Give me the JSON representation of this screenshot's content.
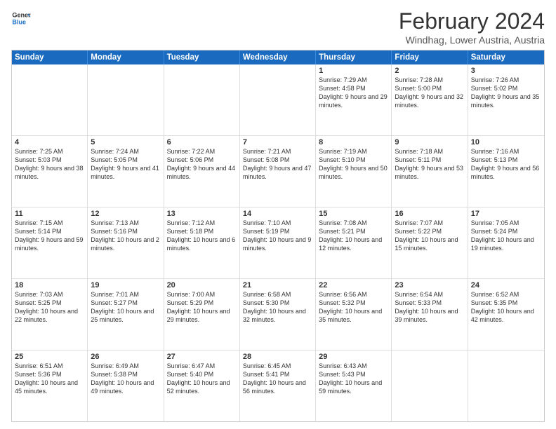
{
  "logo": {
    "line1": "General",
    "line2": "Blue"
  },
  "title": "February 2024",
  "location": "Windhag, Lower Austria, Austria",
  "weekdays": [
    "Sunday",
    "Monday",
    "Tuesday",
    "Wednesday",
    "Thursday",
    "Friday",
    "Saturday"
  ],
  "weeks": [
    [
      {
        "day": "",
        "info": ""
      },
      {
        "day": "",
        "info": ""
      },
      {
        "day": "",
        "info": ""
      },
      {
        "day": "",
        "info": ""
      },
      {
        "day": "1",
        "sunrise": "7:29 AM",
        "sunset": "4:58 PM",
        "daylight": "9 hours and 29 minutes."
      },
      {
        "day": "2",
        "sunrise": "7:28 AM",
        "sunset": "5:00 PM",
        "daylight": "9 hours and 32 minutes."
      },
      {
        "day": "3",
        "sunrise": "7:26 AM",
        "sunset": "5:02 PM",
        "daylight": "9 hours and 35 minutes."
      }
    ],
    [
      {
        "day": "4",
        "sunrise": "7:25 AM",
        "sunset": "5:03 PM",
        "daylight": "9 hours and 38 minutes."
      },
      {
        "day": "5",
        "sunrise": "7:24 AM",
        "sunset": "5:05 PM",
        "daylight": "9 hours and 41 minutes."
      },
      {
        "day": "6",
        "sunrise": "7:22 AM",
        "sunset": "5:06 PM",
        "daylight": "9 hours and 44 minutes."
      },
      {
        "day": "7",
        "sunrise": "7:21 AM",
        "sunset": "5:08 PM",
        "daylight": "9 hours and 47 minutes."
      },
      {
        "day": "8",
        "sunrise": "7:19 AM",
        "sunset": "5:10 PM",
        "daylight": "9 hours and 50 minutes."
      },
      {
        "day": "9",
        "sunrise": "7:18 AM",
        "sunset": "5:11 PM",
        "daylight": "9 hours and 53 minutes."
      },
      {
        "day": "10",
        "sunrise": "7:16 AM",
        "sunset": "5:13 PM",
        "daylight": "9 hours and 56 minutes."
      }
    ],
    [
      {
        "day": "11",
        "sunrise": "7:15 AM",
        "sunset": "5:14 PM",
        "daylight": "9 hours and 59 minutes."
      },
      {
        "day": "12",
        "sunrise": "7:13 AM",
        "sunset": "5:16 PM",
        "daylight": "10 hours and 2 minutes."
      },
      {
        "day": "13",
        "sunrise": "7:12 AM",
        "sunset": "5:18 PM",
        "daylight": "10 hours and 6 minutes."
      },
      {
        "day": "14",
        "sunrise": "7:10 AM",
        "sunset": "5:19 PM",
        "daylight": "10 hours and 9 minutes."
      },
      {
        "day": "15",
        "sunrise": "7:08 AM",
        "sunset": "5:21 PM",
        "daylight": "10 hours and 12 minutes."
      },
      {
        "day": "16",
        "sunrise": "7:07 AM",
        "sunset": "5:22 PM",
        "daylight": "10 hours and 15 minutes."
      },
      {
        "day": "17",
        "sunrise": "7:05 AM",
        "sunset": "5:24 PM",
        "daylight": "10 hours and 19 minutes."
      }
    ],
    [
      {
        "day": "18",
        "sunrise": "7:03 AM",
        "sunset": "5:25 PM",
        "daylight": "10 hours and 22 minutes."
      },
      {
        "day": "19",
        "sunrise": "7:01 AM",
        "sunset": "5:27 PM",
        "daylight": "10 hours and 25 minutes."
      },
      {
        "day": "20",
        "sunrise": "7:00 AM",
        "sunset": "5:29 PM",
        "daylight": "10 hours and 29 minutes."
      },
      {
        "day": "21",
        "sunrise": "6:58 AM",
        "sunset": "5:30 PM",
        "daylight": "10 hours and 32 minutes."
      },
      {
        "day": "22",
        "sunrise": "6:56 AM",
        "sunset": "5:32 PM",
        "daylight": "10 hours and 35 minutes."
      },
      {
        "day": "23",
        "sunrise": "6:54 AM",
        "sunset": "5:33 PM",
        "daylight": "10 hours and 39 minutes."
      },
      {
        "day": "24",
        "sunrise": "6:52 AM",
        "sunset": "5:35 PM",
        "daylight": "10 hours and 42 minutes."
      }
    ],
    [
      {
        "day": "25",
        "sunrise": "6:51 AM",
        "sunset": "5:36 PM",
        "daylight": "10 hours and 45 minutes."
      },
      {
        "day": "26",
        "sunrise": "6:49 AM",
        "sunset": "5:38 PM",
        "daylight": "10 hours and 49 minutes."
      },
      {
        "day": "27",
        "sunrise": "6:47 AM",
        "sunset": "5:40 PM",
        "daylight": "10 hours and 52 minutes."
      },
      {
        "day": "28",
        "sunrise": "6:45 AM",
        "sunset": "5:41 PM",
        "daylight": "10 hours and 56 minutes."
      },
      {
        "day": "29",
        "sunrise": "6:43 AM",
        "sunset": "5:43 PM",
        "daylight": "10 hours and 59 minutes."
      },
      {
        "day": "",
        "info": ""
      },
      {
        "day": "",
        "info": ""
      }
    ]
  ],
  "labels": {
    "sunrise": "Sunrise:",
    "sunset": "Sunset:",
    "daylight": "Daylight:"
  }
}
